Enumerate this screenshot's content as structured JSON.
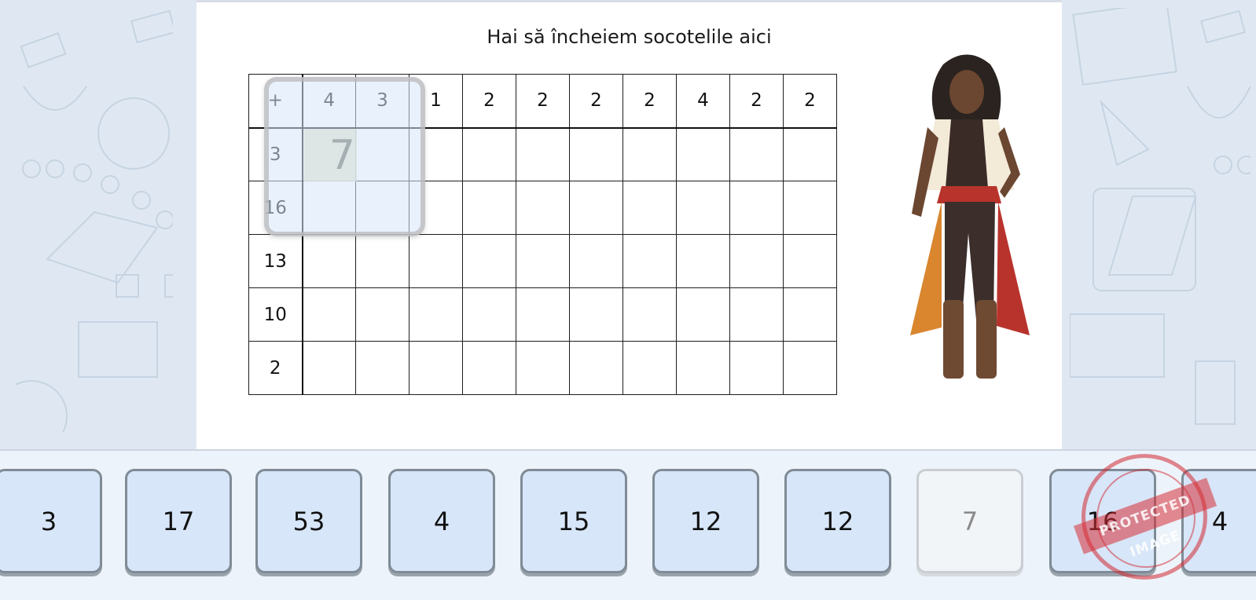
{
  "title": "Hai să încheiem socotelile aici",
  "grid": {
    "corner": "+",
    "header": [
      "4",
      "3",
      "1",
      "2",
      "2",
      "2",
      "2",
      "4",
      "2",
      "2"
    ],
    "rows": [
      {
        "label": "3",
        "cells": [
          "7",
          "",
          "",
          "",
          "",
          "",
          "",
          "",
          "",
          ""
        ]
      },
      {
        "label": "16",
        "cells": [
          "",
          "",
          "",
          "",
          "",
          "",
          "",
          "",
          "",
          ""
        ]
      },
      {
        "label": "13",
        "cells": [
          "",
          "",
          "",
          "",
          "",
          "",
          "",
          "",
          "",
          ""
        ]
      },
      {
        "label": "10",
        "cells": [
          "",
          "",
          "",
          "",
          "",
          "",
          "",
          "",
          "",
          ""
        ]
      },
      {
        "label": "2",
        "cells": [
          "",
          "",
          "",
          "",
          "",
          "",
          "",
          "",
          "",
          ""
        ]
      }
    ],
    "highlighted_value": "7"
  },
  "tiles": [
    {
      "value": "3",
      "used": false
    },
    {
      "value": "17",
      "used": false
    },
    {
      "value": "53",
      "used": false
    },
    {
      "value": "4",
      "used": false
    },
    {
      "value": "15",
      "used": false
    },
    {
      "value": "12",
      "used": false
    },
    {
      "value": "12",
      "used": false
    },
    {
      "value": "7",
      "used": true
    },
    {
      "value": "16",
      "used": false
    },
    {
      "value": "4",
      "used": false
    }
  ],
  "stamp_text": "PROTECTED IMAGE",
  "character": "pirate-woman-illustration",
  "colors": {
    "tile_bg": "#d7e6f8",
    "tile_border": "#7f8b96",
    "highlight_cell": "#e2e2c4",
    "stamp": "#d72d37"
  }
}
